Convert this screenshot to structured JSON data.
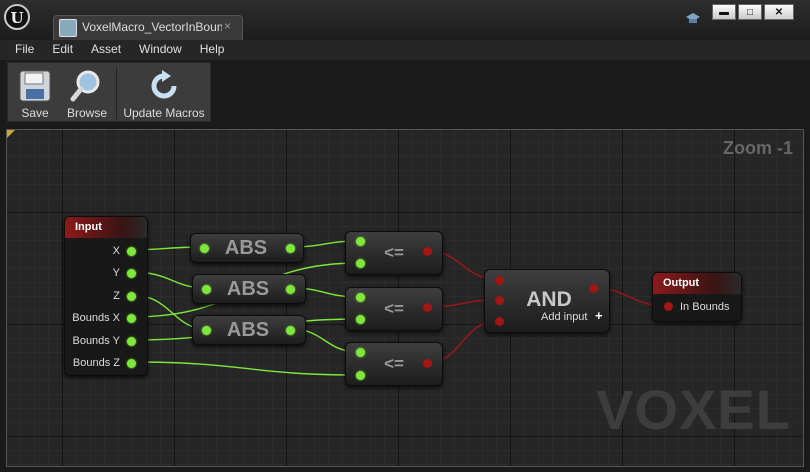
{
  "window": {
    "tab_label": "VoxelMacro_VectorInBounds",
    "tab_close": "×",
    "controls": {
      "minimize": "▬",
      "maximize": "□",
      "close": "✕"
    }
  },
  "menu": [
    "File",
    "Edit",
    "Asset",
    "Window",
    "Help"
  ],
  "toolbar": {
    "save_label": "Save",
    "browse_label": "Browse",
    "update_macros_label": "Update Macros"
  },
  "graph": {
    "zoom_label": "Zoom -1",
    "watermark": "VOXEL",
    "input_node": {
      "title": "Input",
      "pins": [
        "X",
        "Y",
        "Z",
        "Bounds X",
        "Bounds Y",
        "Bounds Z"
      ]
    },
    "abs_nodes": [
      "ABS",
      "ABS",
      "ABS"
    ],
    "compare_nodes": [
      "<=",
      "<=",
      "<="
    ],
    "and_node": {
      "title": "AND",
      "add_input_label": "Add input",
      "add_icon": "+"
    },
    "output_node": {
      "title": "Output",
      "pins": [
        "In Bounds"
      ]
    }
  },
  "colors": {
    "float_wire": "#7ee83a",
    "bool_wire": "#a21616",
    "header_red": "#8c1a1a",
    "graph_bg": "#262626"
  },
  "icons": [
    "save-icon",
    "browse-icon",
    "update-macros-icon",
    "unreal-logo-icon",
    "tab-asset-icon",
    "graduation-hat-icon"
  ]
}
